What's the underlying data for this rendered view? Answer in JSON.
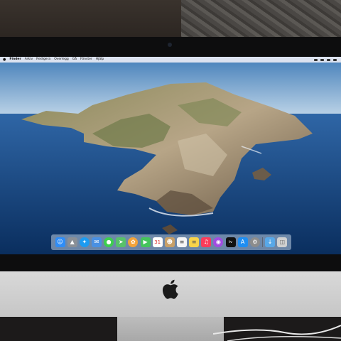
{
  "menubar": {
    "app_name": "Finder",
    "items": [
      "Arkiv",
      "Redigera",
      "Overlegg",
      "Gå",
      "Fönster",
      "Hjälp"
    ]
  },
  "dock": {
    "icons": [
      "finder-icon",
      "launchpad-icon",
      "safari-icon",
      "mail-icon",
      "messages-icon",
      "maps-icon",
      "photos-icon",
      "facetime-icon",
      "calendar-icon",
      "contacts-icon",
      "reminders-icon",
      "notes-icon",
      "music-icon",
      "podcasts-icon",
      "appletv-icon",
      "appstore-icon",
      "system-preferences-icon",
      "downloads-folder-icon",
      "trash-icon"
    ],
    "colors": [
      "#2f8df7",
      "#8a8f96",
      "#1d9bf0",
      "#4a90e2",
      "#3ccf4e",
      "#58c16a",
      "#f2a33b",
      "#44c45b",
      "#ffffff",
      "#c8a068",
      "#f5f5f5",
      "#f7d34a",
      "#fa3c5a",
      "#a24de0",
      "#111111",
      "#1f8ef1",
      "#8c8c8c",
      "#58a8e8",
      "#d0d0d0"
    ]
  },
  "colors": {
    "sky_top": "#5b8fc4",
    "sea": "#123f7a",
    "land": "#a49278",
    "chin": "#d4d4d4"
  }
}
